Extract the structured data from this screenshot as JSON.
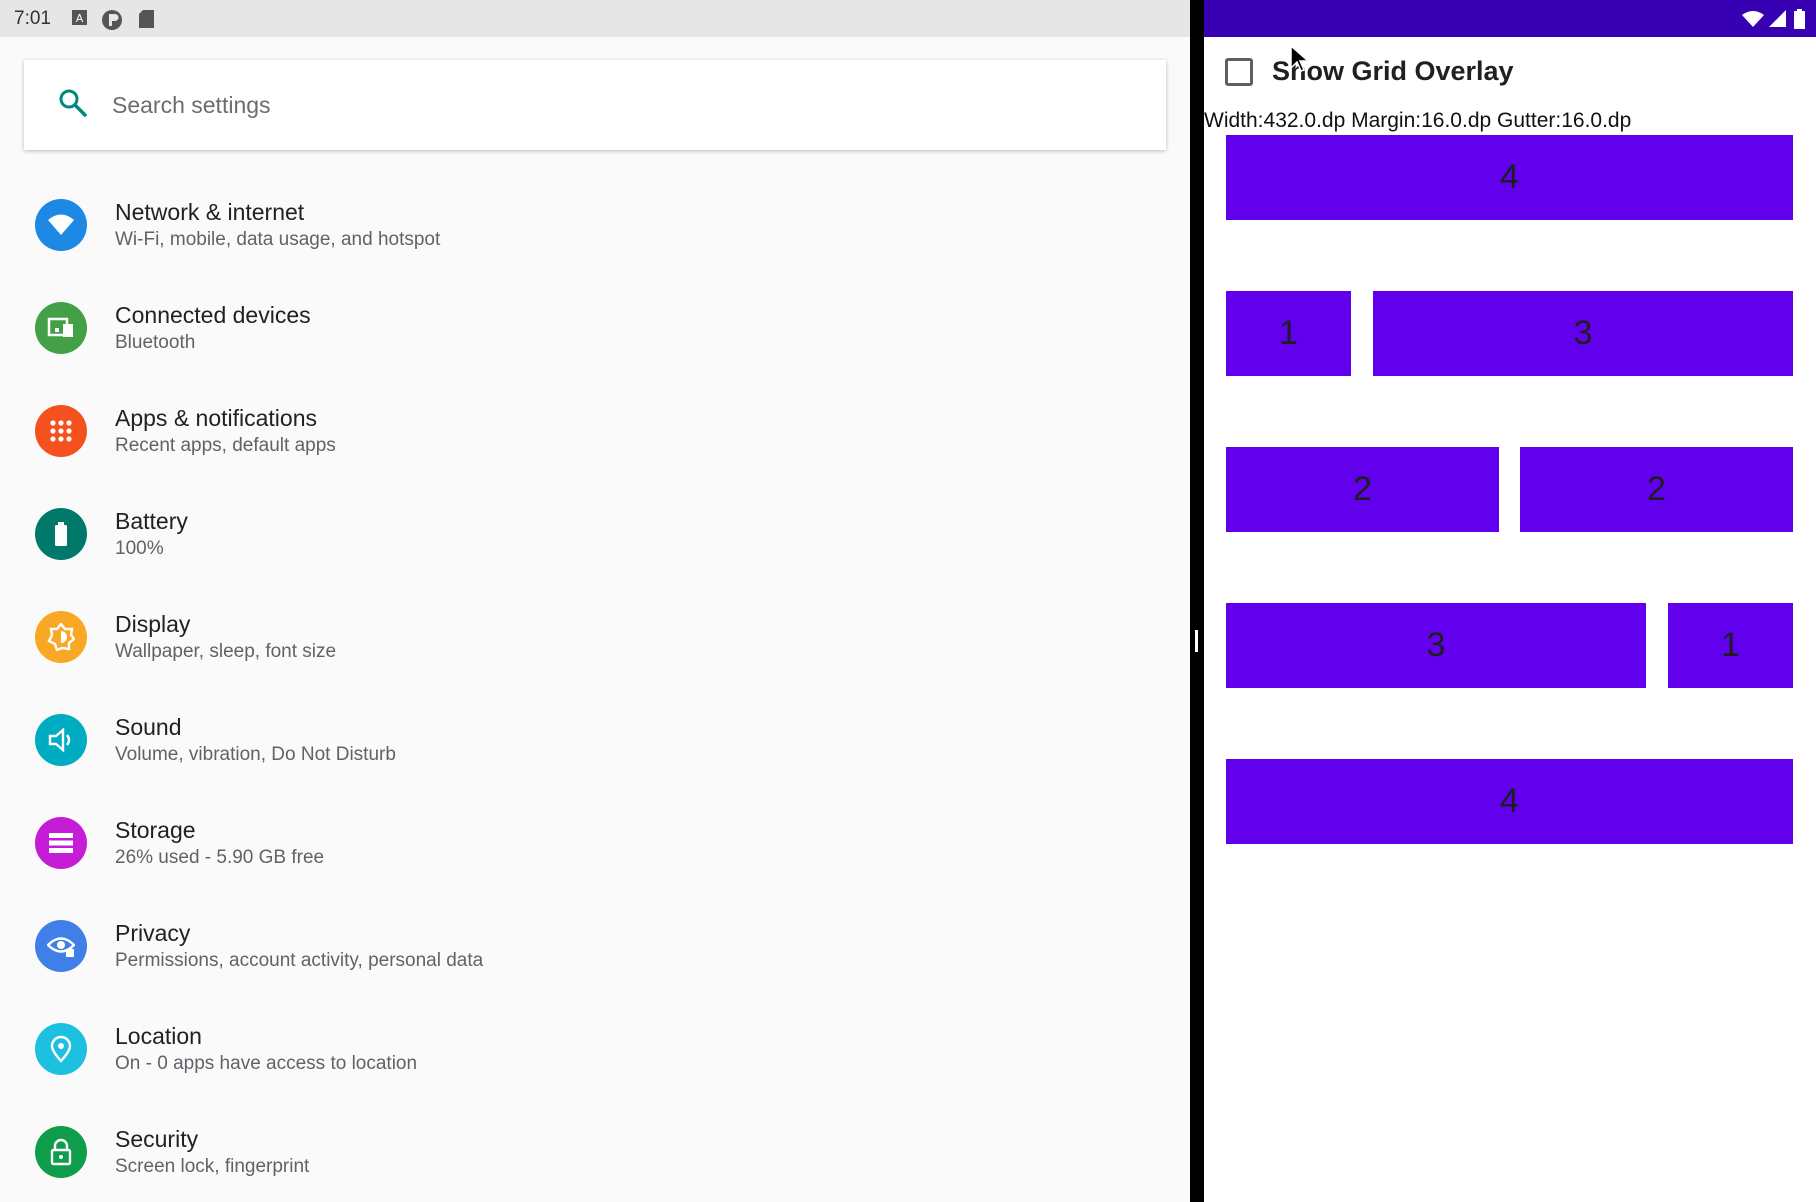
{
  "status_bar": {
    "time": "7:01",
    "left_icons": [
      "accessibility-icon",
      "lock-p-icon",
      "sd-card-icon"
    ],
    "right_icons": [
      "wifi-icon",
      "signal-icon",
      "battery-icon"
    ]
  },
  "search": {
    "placeholder": "Search settings",
    "icon": "search-icon"
  },
  "settings_items": [
    {
      "title": "Network & internet",
      "subtitle": "Wi-Fi, mobile, data usage, and hotspot",
      "icon": "wifi-icon",
      "color": "#1e88e5"
    },
    {
      "title": "Connected devices",
      "subtitle": "Bluetooth",
      "icon": "devices-icon",
      "color": "#43a047"
    },
    {
      "title": "Apps & notifications",
      "subtitle": "Recent apps, default apps",
      "icon": "apps-icon",
      "color": "#f4511e"
    },
    {
      "title": "Battery",
      "subtitle": "100%",
      "icon": "battery-icon",
      "color": "#00796b"
    },
    {
      "title": "Display",
      "subtitle": "Wallpaper, sleep, font size",
      "icon": "brightness-icon",
      "color": "#f9a825"
    },
    {
      "title": "Sound",
      "subtitle": "Volume, vibration, Do Not Disturb",
      "icon": "volume-icon",
      "color": "#00acc1"
    },
    {
      "title": "Storage",
      "subtitle": "26% used - 5.90 GB free",
      "icon": "storage-icon",
      "color": "#c51dd6"
    },
    {
      "title": "Privacy",
      "subtitle": "Permissions, account activity, personal data",
      "icon": "privacy-eye-icon",
      "color": "#3f7fe8"
    },
    {
      "title": "Location",
      "subtitle": "On - 0 apps have access to location",
      "icon": "location-pin-icon",
      "color": "#1ec0e0"
    },
    {
      "title": "Security",
      "subtitle": "Screen lock, fingerprint",
      "icon": "lock-icon",
      "color": "#0e9d4a"
    }
  ],
  "grid_app": {
    "checkbox_label": "Show Grid Overlay",
    "checkbox_checked": false,
    "metrics_text": "Width:432.0.dp Margin:16.0.dp Gutter:16.0.dp",
    "box_color": "#6200ee",
    "rows": [
      [
        "4"
      ],
      [
        "1",
        "3"
      ],
      [
        "2",
        "2"
      ],
      [
        "3",
        "1"
      ],
      [
        "4"
      ]
    ]
  }
}
